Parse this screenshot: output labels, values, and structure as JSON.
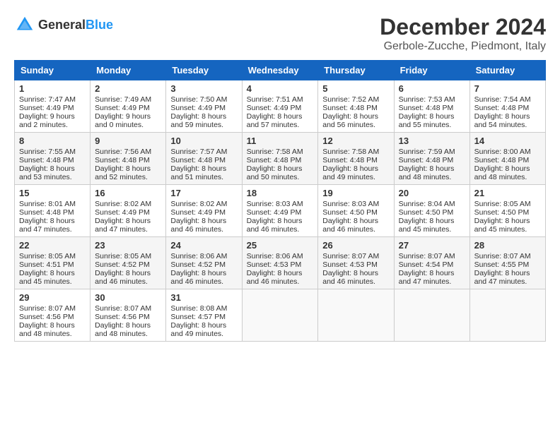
{
  "header": {
    "logo_general": "General",
    "logo_blue": "Blue",
    "title": "December 2024",
    "location": "Gerbole-Zucche, Piedmont, Italy"
  },
  "days_of_week": [
    "Sunday",
    "Monday",
    "Tuesday",
    "Wednesday",
    "Thursday",
    "Friday",
    "Saturday"
  ],
  "weeks": [
    [
      {
        "day": "1",
        "sunrise": "Sunrise: 7:47 AM",
        "sunset": "Sunset: 4:49 PM",
        "daylight": "Daylight: 9 hours and 2 minutes."
      },
      {
        "day": "2",
        "sunrise": "Sunrise: 7:49 AM",
        "sunset": "Sunset: 4:49 PM",
        "daylight": "Daylight: 9 hours and 0 minutes."
      },
      {
        "day": "3",
        "sunrise": "Sunrise: 7:50 AM",
        "sunset": "Sunset: 4:49 PM",
        "daylight": "Daylight: 8 hours and 59 minutes."
      },
      {
        "day": "4",
        "sunrise": "Sunrise: 7:51 AM",
        "sunset": "Sunset: 4:49 PM",
        "daylight": "Daylight: 8 hours and 57 minutes."
      },
      {
        "day": "5",
        "sunrise": "Sunrise: 7:52 AM",
        "sunset": "Sunset: 4:48 PM",
        "daylight": "Daylight: 8 hours and 56 minutes."
      },
      {
        "day": "6",
        "sunrise": "Sunrise: 7:53 AM",
        "sunset": "Sunset: 4:48 PM",
        "daylight": "Daylight: 8 hours and 55 minutes."
      },
      {
        "day": "7",
        "sunrise": "Sunrise: 7:54 AM",
        "sunset": "Sunset: 4:48 PM",
        "daylight": "Daylight: 8 hours and 54 minutes."
      }
    ],
    [
      {
        "day": "8",
        "sunrise": "Sunrise: 7:55 AM",
        "sunset": "Sunset: 4:48 PM",
        "daylight": "Daylight: 8 hours and 53 minutes."
      },
      {
        "day": "9",
        "sunrise": "Sunrise: 7:56 AM",
        "sunset": "Sunset: 4:48 PM",
        "daylight": "Daylight: 8 hours and 52 minutes."
      },
      {
        "day": "10",
        "sunrise": "Sunrise: 7:57 AM",
        "sunset": "Sunset: 4:48 PM",
        "daylight": "Daylight: 8 hours and 51 minutes."
      },
      {
        "day": "11",
        "sunrise": "Sunrise: 7:58 AM",
        "sunset": "Sunset: 4:48 PM",
        "daylight": "Daylight: 8 hours and 50 minutes."
      },
      {
        "day": "12",
        "sunrise": "Sunrise: 7:58 AM",
        "sunset": "Sunset: 4:48 PM",
        "daylight": "Daylight: 8 hours and 49 minutes."
      },
      {
        "day": "13",
        "sunrise": "Sunrise: 7:59 AM",
        "sunset": "Sunset: 4:48 PM",
        "daylight": "Daylight: 8 hours and 48 minutes."
      },
      {
        "day": "14",
        "sunrise": "Sunrise: 8:00 AM",
        "sunset": "Sunset: 4:48 PM",
        "daylight": "Daylight: 8 hours and 48 minutes."
      }
    ],
    [
      {
        "day": "15",
        "sunrise": "Sunrise: 8:01 AM",
        "sunset": "Sunset: 4:48 PM",
        "daylight": "Daylight: 8 hours and 47 minutes."
      },
      {
        "day": "16",
        "sunrise": "Sunrise: 8:02 AM",
        "sunset": "Sunset: 4:49 PM",
        "daylight": "Daylight: 8 hours and 47 minutes."
      },
      {
        "day": "17",
        "sunrise": "Sunrise: 8:02 AM",
        "sunset": "Sunset: 4:49 PM",
        "daylight": "Daylight: 8 hours and 46 minutes."
      },
      {
        "day": "18",
        "sunrise": "Sunrise: 8:03 AM",
        "sunset": "Sunset: 4:49 PM",
        "daylight": "Daylight: 8 hours and 46 minutes."
      },
      {
        "day": "19",
        "sunrise": "Sunrise: 8:03 AM",
        "sunset": "Sunset: 4:50 PM",
        "daylight": "Daylight: 8 hours and 46 minutes."
      },
      {
        "day": "20",
        "sunrise": "Sunrise: 8:04 AM",
        "sunset": "Sunset: 4:50 PM",
        "daylight": "Daylight: 8 hours and 45 minutes."
      },
      {
        "day": "21",
        "sunrise": "Sunrise: 8:05 AM",
        "sunset": "Sunset: 4:50 PM",
        "daylight": "Daylight: 8 hours and 45 minutes."
      }
    ],
    [
      {
        "day": "22",
        "sunrise": "Sunrise: 8:05 AM",
        "sunset": "Sunset: 4:51 PM",
        "daylight": "Daylight: 8 hours and 45 minutes."
      },
      {
        "day": "23",
        "sunrise": "Sunrise: 8:05 AM",
        "sunset": "Sunset: 4:52 PM",
        "daylight": "Daylight: 8 hours and 46 minutes."
      },
      {
        "day": "24",
        "sunrise": "Sunrise: 8:06 AM",
        "sunset": "Sunset: 4:52 PM",
        "daylight": "Daylight: 8 hours and 46 minutes."
      },
      {
        "day": "25",
        "sunrise": "Sunrise: 8:06 AM",
        "sunset": "Sunset: 4:53 PM",
        "daylight": "Daylight: 8 hours and 46 minutes."
      },
      {
        "day": "26",
        "sunrise": "Sunrise: 8:07 AM",
        "sunset": "Sunset: 4:53 PM",
        "daylight": "Daylight: 8 hours and 46 minutes."
      },
      {
        "day": "27",
        "sunrise": "Sunrise: 8:07 AM",
        "sunset": "Sunset: 4:54 PM",
        "daylight": "Daylight: 8 hours and 47 minutes."
      },
      {
        "day": "28",
        "sunrise": "Sunrise: 8:07 AM",
        "sunset": "Sunset: 4:55 PM",
        "daylight": "Daylight: 8 hours and 47 minutes."
      }
    ],
    [
      {
        "day": "29",
        "sunrise": "Sunrise: 8:07 AM",
        "sunset": "Sunset: 4:56 PM",
        "daylight": "Daylight: 8 hours and 48 minutes."
      },
      {
        "day": "30",
        "sunrise": "Sunrise: 8:07 AM",
        "sunset": "Sunset: 4:56 PM",
        "daylight": "Daylight: 8 hours and 48 minutes."
      },
      {
        "day": "31",
        "sunrise": "Sunrise: 8:08 AM",
        "sunset": "Sunset: 4:57 PM",
        "daylight": "Daylight: 8 hours and 49 minutes."
      },
      null,
      null,
      null,
      null
    ]
  ]
}
